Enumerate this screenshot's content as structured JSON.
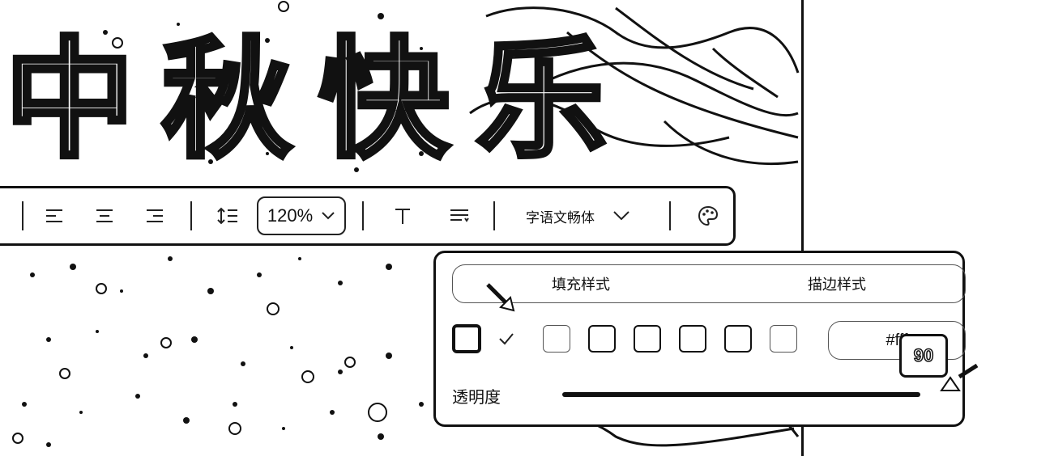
{
  "banner": {
    "chars": [
      "中",
      "秋",
      "快",
      "乐"
    ]
  },
  "toolbar": {
    "align_left_icon": "align-left-icon",
    "align_center_icon": "align-center-icon",
    "align_right_icon": "align-right-icon",
    "line_height_icon": "line-height-icon",
    "zoom_value": "120%",
    "text_icon": "text-icon",
    "paragraph_icon": "paragraph-icon",
    "font_name": "字语文畅体",
    "palette_icon": "palette-icon"
  },
  "style_panel": {
    "tabs": [
      {
        "label": "填充样式"
      },
      {
        "label": "描边样式"
      }
    ],
    "swatch_count": 8,
    "hex_value": "#fff",
    "opacity_label": "透明度",
    "opacity_value": "90"
  },
  "colors": {
    "ink": "#111111",
    "paper": "#ffffff"
  }
}
